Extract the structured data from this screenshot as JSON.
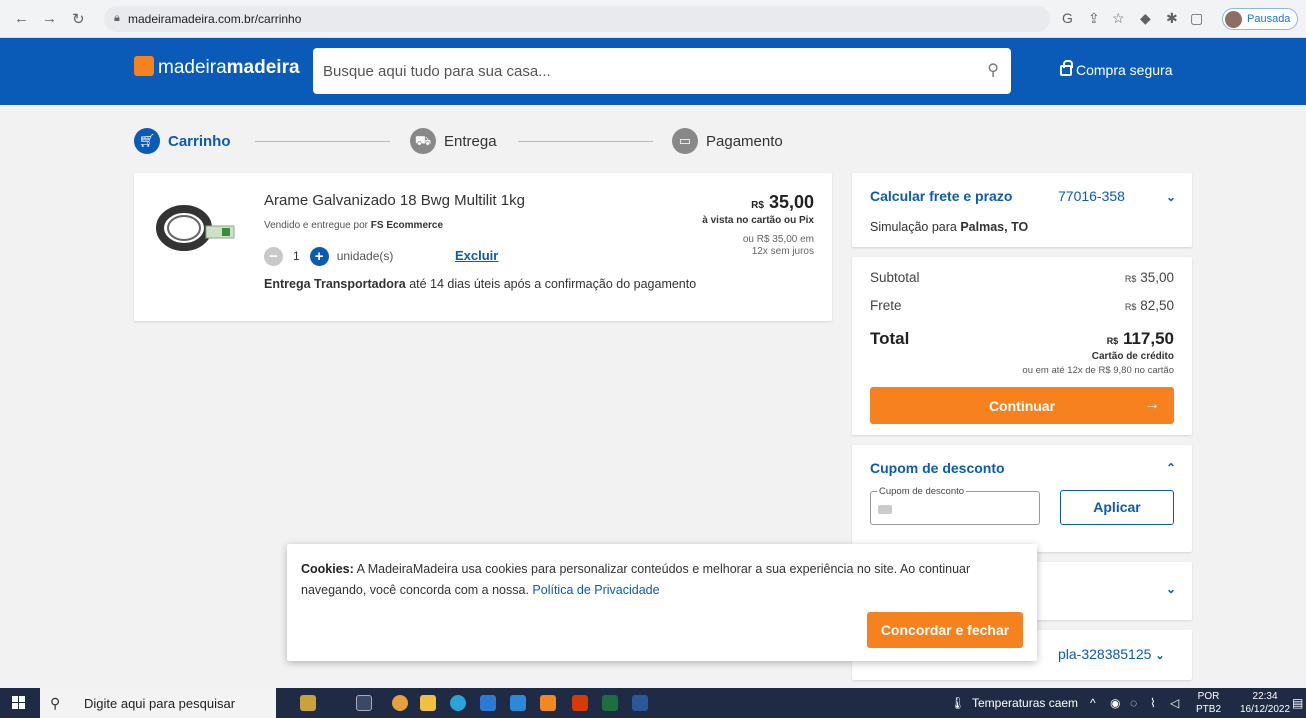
{
  "browser": {
    "url": "madeiramadeira.com.br/carrinho",
    "profile_status": "Pausada"
  },
  "header": {
    "logo_regular": "madeira",
    "logo_bold": "madeira",
    "search_placeholder": "Busque aqui tudo para sua casa...",
    "secure_label": "Compra segura",
    "brand_color": "#0a5bb8",
    "accent_color": "#f5821f"
  },
  "steps": [
    {
      "label": "Carrinho",
      "icon": "cart-icon",
      "active": true
    },
    {
      "label": "Entrega",
      "icon": "truck-icon",
      "active": false
    },
    {
      "label": "Pagamento",
      "icon": "card-icon",
      "active": false
    }
  ],
  "cart_item": {
    "name": "Arame Galvanizado 18 Bwg Multilit 1kg",
    "seller_prefix": "Vendido e entregue por",
    "seller": "FS Ecommerce",
    "quantity": "1",
    "unit": "unidade(s)",
    "remove_label": "Excluir",
    "price_currency": "R$",
    "price": "35,00",
    "price_note": "à vista no cartão ou Pix",
    "installments_line1": "ou R$ 35,00 em",
    "installments_line2": "12x sem juros",
    "delivery_bold": "Entrega Transportadora",
    "delivery_rest": "até 14 dias úteis após a confirmação do pagamento"
  },
  "shipping": {
    "title": "Calcular frete e prazo",
    "cep": "77016-358",
    "simulation_prefix": "Simulação para",
    "simulation_city": "Palmas, TO"
  },
  "summary": {
    "subtotal_label": "Subtotal",
    "subtotal_currency": "R$",
    "subtotal_value": "35,00",
    "frete_label": "Frete",
    "frete_currency": "R$",
    "frete_value": "82,50",
    "total_label": "Total",
    "total_currency": "R$",
    "total_value": "117,50",
    "payment_note": "Cartão de crédito",
    "installments_note": "ou em até 12x de R$ 9,80 no cartão",
    "continue_label": "Continuar"
  },
  "coupon": {
    "title": "Cupom de desconto",
    "field_label": "Cupom de desconto",
    "apply_label": "Aplicar"
  },
  "extra": {
    "pla_code": "pla-328385125"
  },
  "cookie": {
    "bold": "Cookies:",
    "text": "A MadeiraMadeira usa cookies para personalizar conteúdos e melhorar a sua experiência no site. Ao continuar navegando, você concorda com a nossa.",
    "link": "Política de Privacidade",
    "accept_label": "Concordar e fechar"
  },
  "taskbar": {
    "search_placeholder": "Digite aqui para pesquisar",
    "weather": "Temperaturas caem",
    "lang_line1": "POR",
    "lang_line2": "PTB2",
    "time": "22:34",
    "date": "16/12/2022"
  }
}
